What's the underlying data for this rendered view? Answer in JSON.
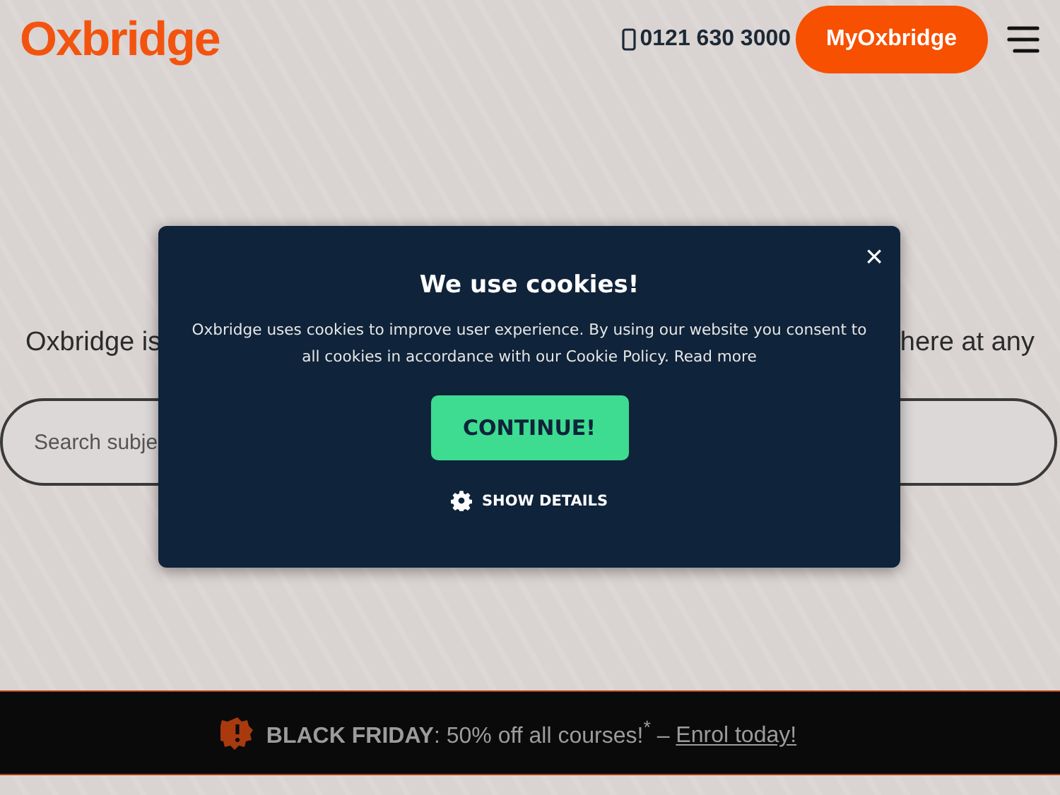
{
  "header": {
    "logo": "Oxbridge",
    "phone": "0121 630 3000",
    "account_button": "MyOxbridge"
  },
  "hero": {
    "text_left": "Oxbridge is",
    "text_right": "here at any",
    "search": {
      "placeholder": "Search subje"
    }
  },
  "cookie_dialog": {
    "title": "We use cookies!",
    "message": "Oxbridge uses cookies to improve user experience. By using our website you consent to all cookies in accordance with our Cookie Policy.",
    "link": "Read more",
    "close": "×",
    "button": "CONTINUE!",
    "details": "SHOW DETAILS"
  },
  "banner": {
    "text": "**BLACK FRIDAY**: 50% off all courses!$^{*}$ –",
    "link": "Enrol today!"
  }
}
